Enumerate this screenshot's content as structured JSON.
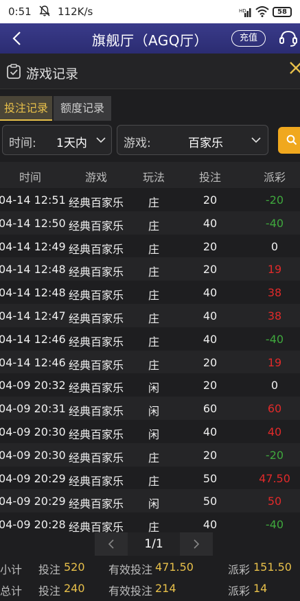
{
  "status_bar": {
    "time": "0:51",
    "speed": "112K/s",
    "battery": "58"
  },
  "header": {
    "title": "旗舰厅（AGQ厅）",
    "recharge_label": "充值"
  },
  "panel": {
    "title": "游戏记录"
  },
  "tabs": [
    {
      "label": "投注记录",
      "active": true
    },
    {
      "label": "额度记录",
      "active": false
    }
  ],
  "filters": {
    "time": {
      "label": "时间:",
      "value": "1天内"
    },
    "game": {
      "label": "游戏:",
      "value": "百家乐"
    }
  },
  "table": {
    "columns": [
      "时间",
      "游戏",
      "玩法",
      "投注",
      "派彩"
    ],
    "rows": [
      {
        "time": "04-14 12:51",
        "game": "经典百家乐",
        "play": "庄",
        "bet": "20",
        "payout": "-20"
      },
      {
        "time": "04-14 12:50",
        "game": "经典百家乐",
        "play": "庄",
        "bet": "40",
        "payout": "-40"
      },
      {
        "time": "04-14 12:49",
        "game": "经典百家乐",
        "play": "庄",
        "bet": "20",
        "payout": "0"
      },
      {
        "time": "04-14 12:48",
        "game": "经典百家乐",
        "play": "庄",
        "bet": "20",
        "payout": "19"
      },
      {
        "time": "04-14 12:48",
        "game": "经典百家乐",
        "play": "庄",
        "bet": "40",
        "payout": "38"
      },
      {
        "time": "04-14 12:47",
        "game": "经典百家乐",
        "play": "庄",
        "bet": "40",
        "payout": "38"
      },
      {
        "time": "04-14 12:46",
        "game": "经典百家乐",
        "play": "庄",
        "bet": "40",
        "payout": "-40"
      },
      {
        "time": "04-14 12:46",
        "game": "经典百家乐",
        "play": "庄",
        "bet": "20",
        "payout": "19"
      },
      {
        "time": "04-09 20:32",
        "game": "经典百家乐",
        "play": "闲",
        "bet": "20",
        "payout": "0"
      },
      {
        "time": "04-09 20:31",
        "game": "经典百家乐",
        "play": "闲",
        "bet": "60",
        "payout": "60"
      },
      {
        "time": "04-09 20:30",
        "game": "经典百家乐",
        "play": "闲",
        "bet": "40",
        "payout": "40"
      },
      {
        "time": "04-09 20:30",
        "game": "经典百家乐",
        "play": "庄",
        "bet": "20",
        "payout": "-20"
      },
      {
        "time": "04-09 20:29",
        "game": "经典百家乐",
        "play": "庄",
        "bet": "50",
        "payout": "47.50"
      },
      {
        "time": "04-09 20:29",
        "game": "经典百家乐",
        "play": "闲",
        "bet": "50",
        "payout": "50"
      },
      {
        "time": "04-09 20:28",
        "game": "经典百家乐",
        "play": "庄",
        "bet": "40",
        "payout": "-40"
      }
    ]
  },
  "pager": {
    "page": "1/1"
  },
  "summary": {
    "subtotal": {
      "label": "小计",
      "bet_label": "投注",
      "bet": "520",
      "valid_label": "有效投注",
      "valid": "471.50",
      "payout_label": "派彩",
      "payout": "151.50"
    },
    "total": {
      "label": "总计",
      "bet_label": "投注",
      "bet": "240",
      "valid_label": "有效投注",
      "valid": "214",
      "payout_label": "派彩",
      "payout": "14"
    }
  },
  "colors": {
    "header_bg": "#2b2c72",
    "accent_gold": "#e8c04a",
    "search_orange": "#f0a81e",
    "payout_negative": "#3fa83d",
    "payout_positive": "#e02a2a"
  }
}
